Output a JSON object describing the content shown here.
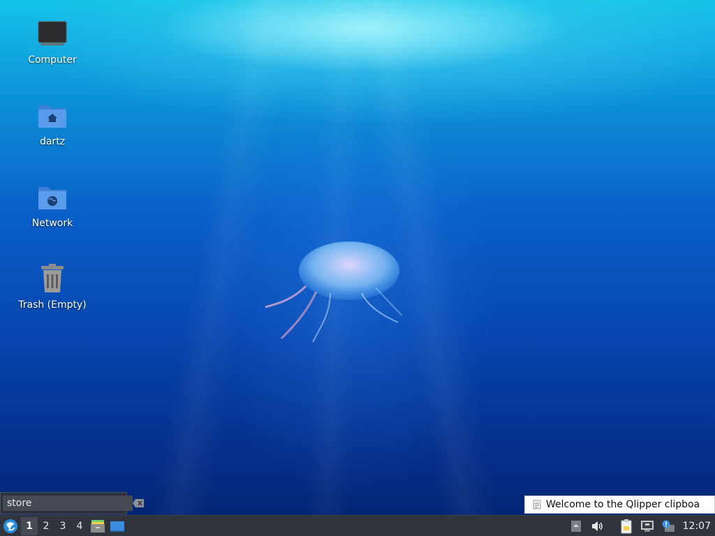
{
  "desktop": {
    "icons": [
      {
        "label": "Computer",
        "icon": "computer-icon"
      },
      {
        "label": "dartz",
        "icon": "home-folder-icon"
      },
      {
        "label": "Network",
        "icon": "network-folder-icon"
      },
      {
        "label": "Trash (Empty)",
        "icon": "trash-icon"
      }
    ]
  },
  "taskbar": {
    "workspaces": [
      "1",
      "2",
      "3",
      "4"
    ],
    "active_workspace": "1",
    "clock": "12:07"
  },
  "search": {
    "value": "store"
  },
  "notification": {
    "text": "Welcome to the Qlipper clipboa"
  },
  "colors": {
    "taskbar_bg": "#30343c",
    "folder_blue": "#4a8be0"
  }
}
